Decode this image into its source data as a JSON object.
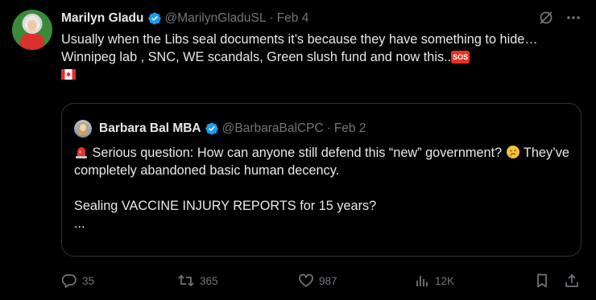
{
  "tweet": {
    "author_name": "Marilyn Gladu",
    "handle": "@MarilynGladuSL",
    "separator": "·",
    "date": "Feb 4",
    "text": "Usually when the Libs seal documents it’s because they have something to hide… Winnipeg lab , SNC, WE scandals, Green slush fund and now this..",
    "sos_emoji": "SOS"
  },
  "quote": {
    "author_name": "Barbara Bal MBA",
    "handle": "@BarbaraBalCPC",
    "separator": "·",
    "date": "Feb 2",
    "line1": " Serious question: How can anyone still defend this “new” government? ",
    "line1b": " They’ve completely abandoned basic human decency.",
    "line2": "Sealing VACCINE INJURY REPORTS for 15 years?",
    "line3": "..."
  },
  "actions": {
    "replies": "35",
    "reposts": "365",
    "likes": "987",
    "views": "12K"
  },
  "icons": {
    "verified": "verified-badge-icon",
    "grok": "grok-icon",
    "more": "more-icon",
    "reply": "reply-icon",
    "repost": "repost-icon",
    "like": "like-icon",
    "views": "views-icon",
    "bookmark": "bookmark-icon",
    "share": "share-icon"
  },
  "colors": {
    "background": "#000000",
    "text": "#e7e9ea",
    "muted": "#71767b",
    "verified": "#1d9bf0",
    "border": "#2f3336"
  }
}
